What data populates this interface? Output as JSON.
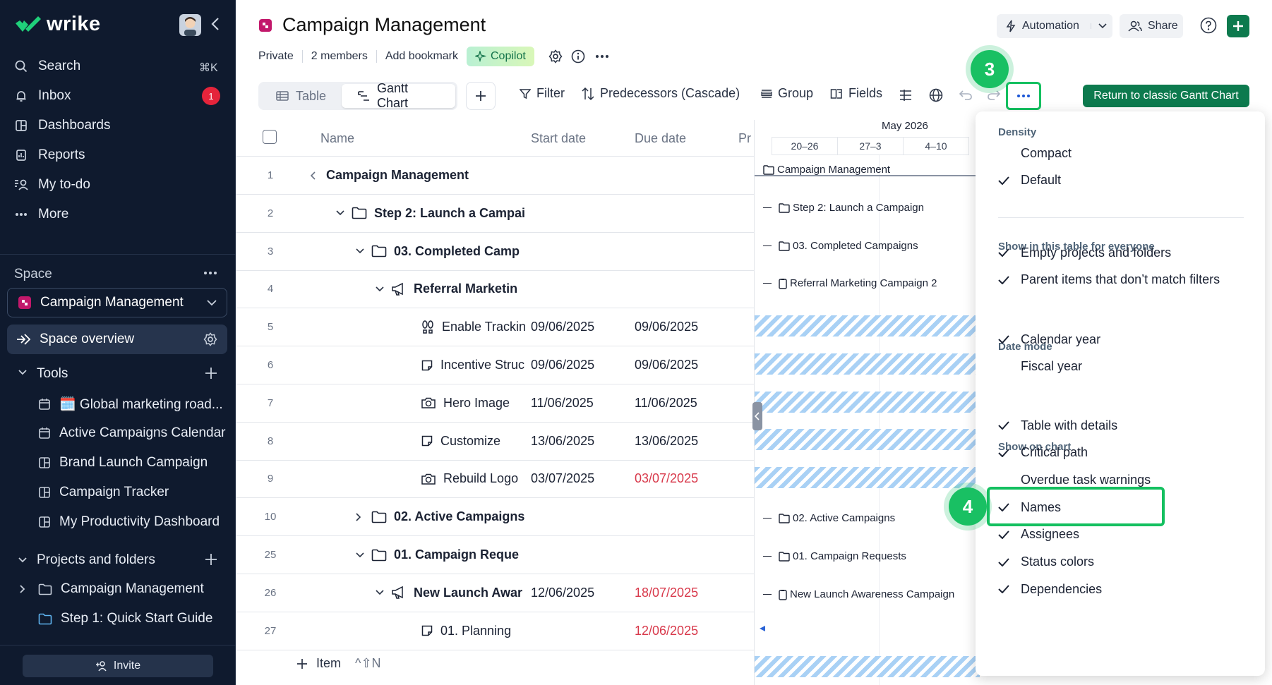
{
  "app": {
    "name": "wrike"
  },
  "sidebar": {
    "search": {
      "label": "Search",
      "shortcut": "⌘K"
    },
    "nav": [
      {
        "label": "Inbox",
        "badge": "1"
      },
      {
        "label": "Dashboards"
      },
      {
        "label": "Reports"
      },
      {
        "label": "My to-do"
      },
      {
        "label": "More"
      }
    ],
    "space_label": "Space",
    "space_selected": "Campaign Management",
    "space_overview": "Space overview",
    "tools_label": "Tools",
    "tools": [
      "🗓️ Global marketing road...",
      "Active Campaigns Calendar",
      "Brand Launch Campaign",
      "Campaign Tracker",
      "My Productivity Dashboard"
    ],
    "projects_label": "Projects and folders",
    "projects": [
      "Campaign Management",
      "Step 1: Quick Start Guide"
    ],
    "invite": "Invite"
  },
  "header": {
    "title": "Campaign Management",
    "privacy": "Private",
    "members": "2 members",
    "bookmark": "Add bookmark",
    "copilot": "Copilot",
    "automation": "Automation",
    "share": "Share"
  },
  "toolbar": {
    "views": [
      "Table",
      "Gantt Chart"
    ],
    "filter": "Filter",
    "predecessors": "Predecessors (Cascade)",
    "group": "Group",
    "fields": "Fields",
    "classic": "Return to classic Gantt Chart"
  },
  "steps": {
    "a": "3",
    "b": "4"
  },
  "table": {
    "headers": {
      "name": "Name",
      "start": "Start date",
      "due": "Due date",
      "extra": "Pr"
    },
    "rows": [
      {
        "num": "1",
        "name": "Campaign Management",
        "start": "",
        "due": "",
        "icon": "project-icon",
        "due_overdue": false
      },
      {
        "num": "2",
        "name": "Step 2: Launch a Campai",
        "start": "",
        "due": "",
        "icon": "folder-icon",
        "due_overdue": false
      },
      {
        "num": "3",
        "name": "03. Completed Camp",
        "start": "",
        "due": "",
        "icon": "folder-icon",
        "due_overdue": false
      },
      {
        "num": "4",
        "name": "Referral Marketin",
        "start": "",
        "due": "",
        "icon": "megaphone-icon",
        "due_overdue": false
      },
      {
        "num": "5",
        "name": "Enable Trackin",
        "start": "09/06/2025",
        "due": "09/06/2025",
        "icon": "footprints-icon",
        "due_overdue": false
      },
      {
        "num": "6",
        "name": "Incentive Struc",
        "start": "09/06/2025",
        "due": "09/06/2025",
        "icon": "task-icon",
        "due_overdue": false
      },
      {
        "num": "7",
        "name": "Hero Image",
        "start": "11/06/2025",
        "due": "11/06/2025",
        "icon": "camera-icon",
        "due_overdue": false
      },
      {
        "num": "8",
        "name": "Customize",
        "start": "13/06/2025",
        "due": "13/06/2025",
        "icon": "task-icon",
        "due_overdue": false
      },
      {
        "num": "9",
        "name": "Rebuild Logo",
        "start": "03/07/2025",
        "due": "03/07/2025",
        "icon": "camera-icon",
        "due_overdue": true
      },
      {
        "num": "10",
        "name": "02. Active Campaigns",
        "start": "",
        "due": "",
        "icon": "folder-icon",
        "due_overdue": false
      },
      {
        "num": "25",
        "name": "01. Campaign Reque",
        "start": "",
        "due": "",
        "icon": "folder-icon",
        "due_overdue": false
      },
      {
        "num": "26",
        "name": "New Launch Awar",
        "start": "12/06/2025",
        "due": "18/07/2025",
        "icon": "megaphone-icon",
        "due_overdue": true
      },
      {
        "num": "27",
        "name": "01. Planning",
        "start": "",
        "due": "12/06/2025",
        "icon": "task-icon",
        "due_overdue": true
      }
    ],
    "add_item": "Item",
    "add_shortcut": "^⇧N"
  },
  "gantt": {
    "month": "May 2026",
    "weeks": [
      "20–26",
      "27–3",
      "4–10"
    ],
    "labels": [
      "Campaign Management",
      "Step 2: Launch a Campaign",
      "03. Completed Campaigns",
      "Referral Marketing Campaign 2",
      "02. Active Campaigns",
      "01. Campaign Requests",
      "New Launch Awareness Campaign"
    ]
  },
  "menu": {
    "density_title": "Density",
    "density": [
      {
        "label": "Compact",
        "checked": false
      },
      {
        "label": "Default",
        "checked": true
      }
    ],
    "show_title": "Show in this table for everyone",
    "show": [
      {
        "label": "Empty projects and folders",
        "checked": true
      },
      {
        "label": "Parent items that don’t match filters",
        "checked": true
      }
    ],
    "date_title": "Date mode",
    "date": [
      {
        "label": "Calendar year",
        "checked": true
      },
      {
        "label": "Fiscal year",
        "checked": false
      }
    ],
    "chart_title": "Show on chart",
    "chart": [
      {
        "label": "Table with details",
        "checked": true
      },
      {
        "label": "Critical path",
        "checked": true
      },
      {
        "label": "Overdue task warnings",
        "checked": false
      },
      {
        "label": "Names",
        "checked": true
      },
      {
        "label": "Assignees",
        "checked": true
      },
      {
        "label": "Status colors",
        "checked": true
      },
      {
        "label": "Dependencies",
        "checked": true
      }
    ]
  },
  "colors": {
    "accent": "#14c060",
    "brand_dark": "#0f1a2e",
    "classic_btn": "#0d7a4e",
    "overdue": "#d8394b"
  }
}
